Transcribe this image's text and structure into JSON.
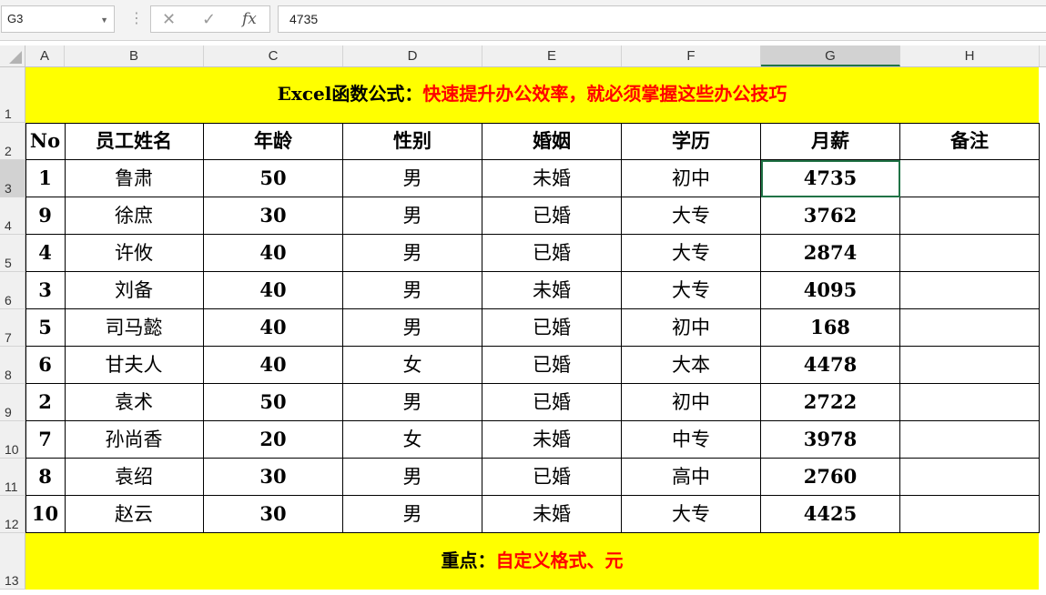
{
  "formula_bar": {
    "name_box": "G3",
    "formula_value": "4735",
    "cancel_glyph": "✕",
    "enter_glyph": "✓",
    "fx_glyph": "fx"
  },
  "columns": [
    "A",
    "B",
    "C",
    "D",
    "E",
    "F",
    "G",
    "H"
  ],
  "rows": [
    "1",
    "2",
    "3",
    "4",
    "5",
    "6",
    "7",
    "8",
    "9",
    "10",
    "11",
    "12",
    "13"
  ],
  "title": {
    "prefix": "Excel函数公式：",
    "highlight": "快速提升办公效率，就必须掌握这些办公技巧"
  },
  "table": {
    "headers": [
      "No",
      "员工姓名",
      "年龄",
      "性别",
      "婚姻",
      "学历",
      "月薪",
      "备注"
    ],
    "rows": [
      [
        "1",
        "鲁肃",
        "50",
        "男",
        "未婚",
        "初中",
        "4735",
        ""
      ],
      [
        "9",
        "徐庶",
        "30",
        "男",
        "已婚",
        "大专",
        "3762",
        ""
      ],
      [
        "4",
        "许攸",
        "40",
        "男",
        "已婚",
        "大专",
        "2874",
        ""
      ],
      [
        "3",
        "刘备",
        "40",
        "男",
        "未婚",
        "大专",
        "4095",
        ""
      ],
      [
        "5",
        "司马懿",
        "40",
        "男",
        "已婚",
        "初中",
        "168",
        ""
      ],
      [
        "6",
        "甘夫人",
        "40",
        "女",
        "已婚",
        "大本",
        "4478",
        ""
      ],
      [
        "2",
        "袁术",
        "50",
        "男",
        "已婚",
        "初中",
        "2722",
        ""
      ],
      [
        "7",
        "孙尚香",
        "20",
        "女",
        "未婚",
        "中专",
        "3978",
        ""
      ],
      [
        "8",
        "袁绍",
        "30",
        "男",
        "已婚",
        "高中",
        "2760",
        ""
      ],
      [
        "10",
        "赵云",
        "30",
        "男",
        "未婚",
        "大专",
        "4425",
        ""
      ]
    ]
  },
  "footer": {
    "prefix": "重点：",
    "highlight": "自定义格式、元"
  },
  "colors": {
    "banner_bg": "#ffff00",
    "highlight_text": "#ff0000",
    "selection": "#217346"
  }
}
